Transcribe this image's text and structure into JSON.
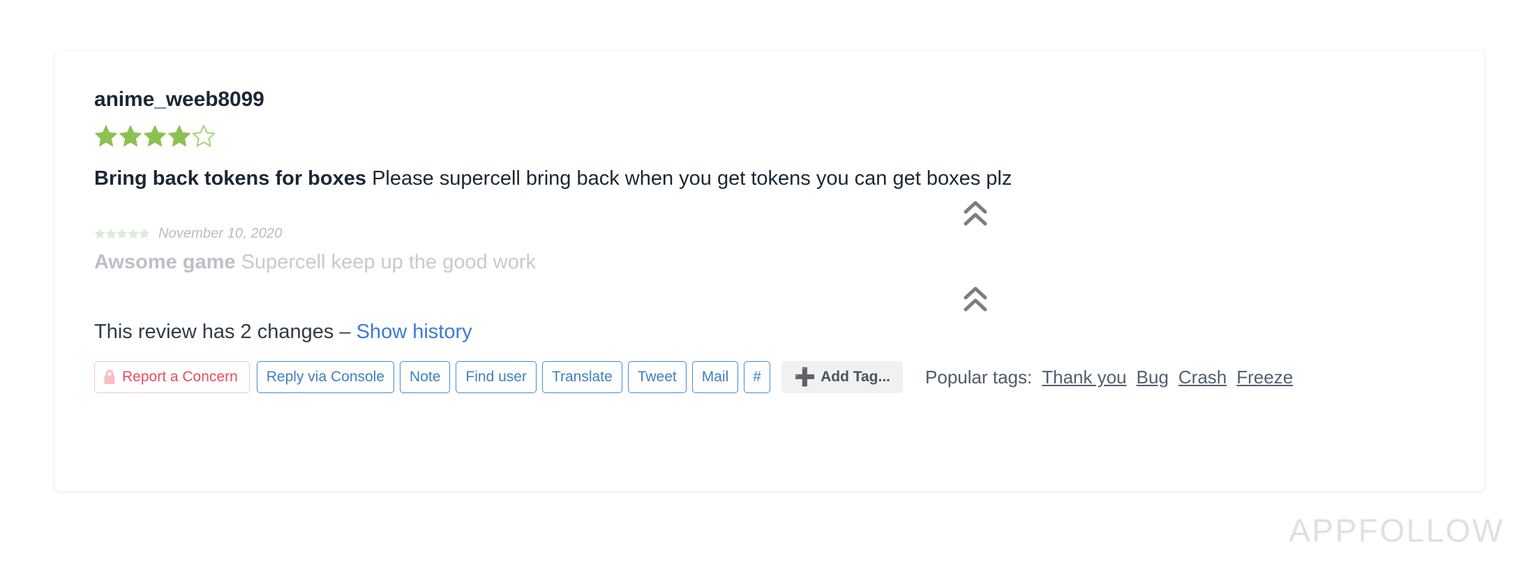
{
  "review": {
    "author": "anime_weeb8099",
    "rating": 4,
    "max_rating": 5,
    "title": "Bring back tokens for boxes",
    "body": "Please supercell bring back when you get tokens you can get boxes plz",
    "collapse_icon_top": "chevron-double-up-icon",
    "collapse_icon_bottom": "chevron-double-up-icon"
  },
  "previous_revision": {
    "rating": 5,
    "date": "November 10, 2020",
    "title": "Awsome game",
    "body": "Supercell keep up the good work"
  },
  "history": {
    "text": "This review has 2 changes – ",
    "link_label": "Show history",
    "changes_count": 2
  },
  "actions": {
    "report": {
      "label": "Report a Concern",
      "icon": "lock-icon",
      "color": "#ec4a5f",
      "border_color": "#f7c6cd"
    },
    "buttons": [
      {
        "label": "Reply via Console",
        "name": "reply-via-console-button"
      },
      {
        "label": "Note",
        "name": "note-button"
      },
      {
        "label": "Find user",
        "name": "find-user-button"
      },
      {
        "label": "Translate",
        "name": "translate-button"
      },
      {
        "label": "Tweet",
        "name": "tweet-button"
      },
      {
        "label": "Mail",
        "name": "mail-button"
      },
      {
        "label": "#",
        "name": "hashtag-button"
      }
    ],
    "add_tag": {
      "label": "Add Tag...",
      "icon": "plus-icon"
    }
  },
  "popular_tags": {
    "label": "Popular tags:",
    "tags": [
      "Thank you",
      "Bug",
      "Crash",
      "Freeze"
    ]
  },
  "watermark": "APPFOLLOW",
  "colors": {
    "star_filled": "#8cc152",
    "star_empty_stroke": "#a8d171",
    "link_blue": "#3a7bd5",
    "button_blue": "#3a8fd6",
    "text_dark": "#1b2733",
    "faded_text": "#c6cacf",
    "watermark": "#dde1e6"
  }
}
